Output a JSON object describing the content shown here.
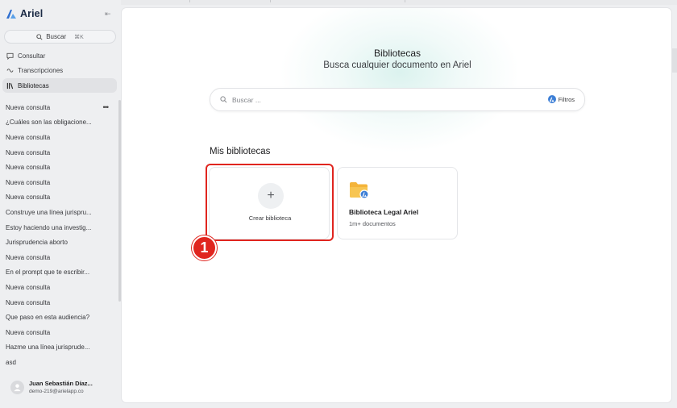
{
  "app": {
    "name": "Ariel"
  },
  "sidebar": {
    "search": {
      "label": "Buscar",
      "shortcut": "⌘K"
    },
    "nav": [
      {
        "label": "Consultar",
        "icon": "chat-icon",
        "active": false
      },
      {
        "label": "Transcripciones",
        "icon": "transcription-icon",
        "active": false
      },
      {
        "label": "Bibliotecas",
        "icon": "library-icon",
        "active": true
      }
    ],
    "history": [
      "Nueva consulta",
      "¿Cuáles son las obligacione...",
      "Nueva consulta",
      "Nueva consulta",
      "Nueva consulta",
      "Nueva consulta",
      "Nueva consulta",
      "Construye una línea jurispru...",
      "Estoy haciendo una investig...",
      "Jurisprudencia aborto",
      "Nueva consulta",
      "En el prompt que te escribir...",
      "Nueva consulta",
      "Nueva consulta",
      "Que paso en esta audiencia?",
      "Nueva consulta",
      "Hazme una línea jurisprude...",
      "asd"
    ],
    "history_menu": "•••",
    "user": {
      "name": "Juan Sebastián Díaz...",
      "email": "demo-219@arielapp.co"
    }
  },
  "main": {
    "title": "Bibliotecas",
    "subtitle": "Busca cualquier documento en Ariel",
    "search": {
      "placeholder": "Buscar ...",
      "filters_label": "Filtros"
    },
    "section_title": "Mis bibliotecas",
    "create_card": {
      "icon": "+",
      "label": "Crear biblioteca"
    },
    "libraries": [
      {
        "name": "Biblioteca Legal Ariel",
        "count": "1m+ documentos",
        "icon": "folder-icon"
      }
    ]
  },
  "annotation": {
    "step": "1",
    "color": "#e0251f"
  },
  "colors": {
    "accent": "#3d7fd6",
    "brand": "#1b2a45",
    "annotation": "#e0251f",
    "folder": "#f4b43a"
  }
}
